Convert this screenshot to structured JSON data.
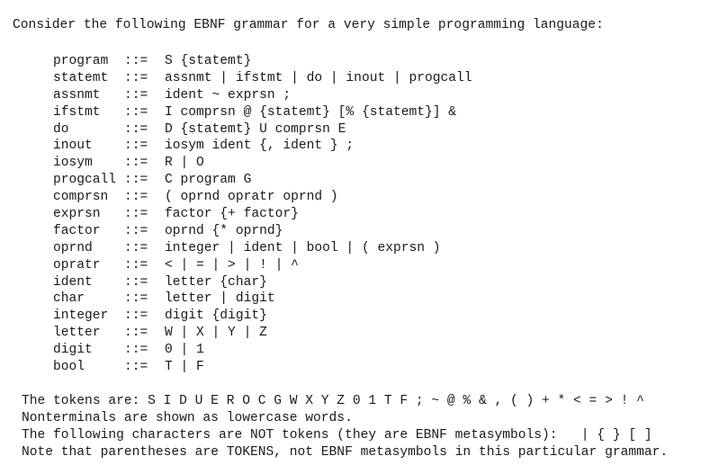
{
  "intro": "Consider the following EBNF grammar for a very simple programming language:",
  "grammar": {
    "operator": "::=",
    "rules": [
      {
        "lhs": "program",
        "rhs": "S {statemt}"
      },
      {
        "lhs": "statemt",
        "rhs": "assnmt | ifstmt | do | inout | progcall"
      },
      {
        "lhs": "assnmt",
        "rhs": "ident ~ exprsn ;"
      },
      {
        "lhs": "ifstmt",
        "rhs": "I comprsn @ {statemt} [% {statemt}] &"
      },
      {
        "lhs": "do",
        "rhs": "D {statemt} U comprsn E"
      },
      {
        "lhs": "inout",
        "rhs": "iosym ident {, ident } ;"
      },
      {
        "lhs": "iosym",
        "rhs": "R | O"
      },
      {
        "lhs": "progcall",
        "rhs": "C program G"
      },
      {
        "lhs": "comprsn",
        "rhs": "( oprnd opratr oprnd )"
      },
      {
        "lhs": "exprsn",
        "rhs": "factor {+ factor}"
      },
      {
        "lhs": "factor",
        "rhs": "oprnd {* oprnd}"
      },
      {
        "lhs": "oprnd",
        "rhs": "integer | ident | bool | ( exprsn )"
      },
      {
        "lhs": "opratr",
        "rhs": "< | = | > | ! | ^"
      },
      {
        "lhs": "ident",
        "rhs": "letter {char}"
      },
      {
        "lhs": "char",
        "rhs": "letter | digit"
      },
      {
        "lhs": "integer",
        "rhs": "digit {digit}"
      },
      {
        "lhs": "letter",
        "rhs": "W | X | Y | Z"
      },
      {
        "lhs": "digit",
        "rhs": "0 | 1"
      },
      {
        "lhs": "bool",
        "rhs": "T | F"
      }
    ]
  },
  "notes": [
    "The tokens are: S I D U E R O C G W X Y Z 0 1 T F ; ~ @ % & , ( ) + * < = > ! ^",
    "Nonterminals are shown as lowercase words.",
    "The following characters are NOT tokens (they are EBNF metasymbols):   | { } [ ]",
    "Note that parentheses are TOKENS, not EBNF metasymbols in this particular grammar."
  ]
}
